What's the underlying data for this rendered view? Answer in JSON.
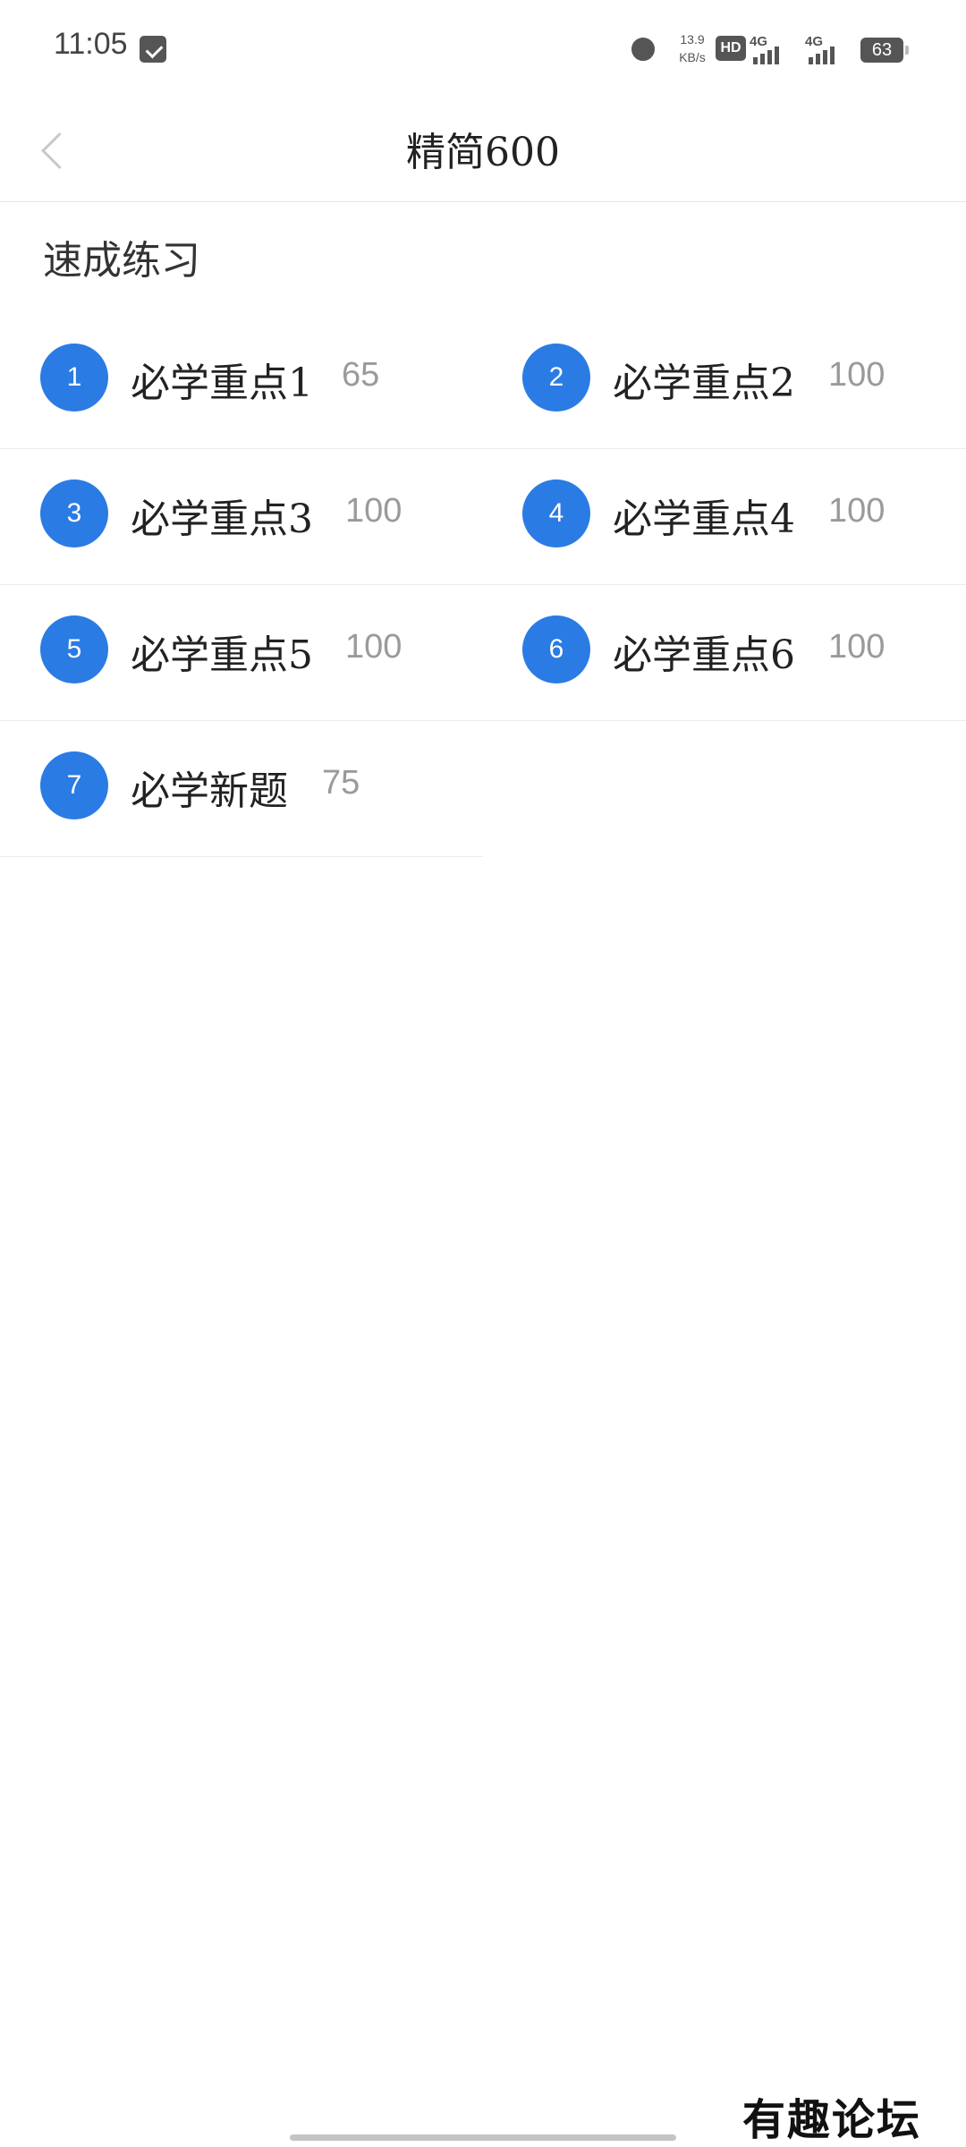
{
  "status_bar": {
    "time": "11:05",
    "net_speed_value": "13.9",
    "net_speed_unit": "KB/s",
    "hd_label": "HD",
    "signal1_label": "4G",
    "signal2_label": "4G",
    "battery": "63"
  },
  "header": {
    "title": "精简600"
  },
  "section": {
    "title": "速成练习"
  },
  "items": [
    {
      "index": "1",
      "name": "必学重点1",
      "count": "65"
    },
    {
      "index": "2",
      "name": "必学重点2",
      "count": "100"
    },
    {
      "index": "3",
      "name": "必学重点3",
      "count": "100"
    },
    {
      "index": "4",
      "name": "必学重点4",
      "count": "100"
    },
    {
      "index": "5",
      "name": "必学重点5",
      "count": "100"
    },
    {
      "index": "6",
      "name": "必学重点6",
      "count": "100"
    },
    {
      "index": "7",
      "name": "必学新题",
      "count": "75"
    }
  ],
  "watermark": "有趣论坛",
  "colors": {
    "accent": "#2b7be4",
    "count_text": "#9a9a9a",
    "divider": "#ececec"
  }
}
